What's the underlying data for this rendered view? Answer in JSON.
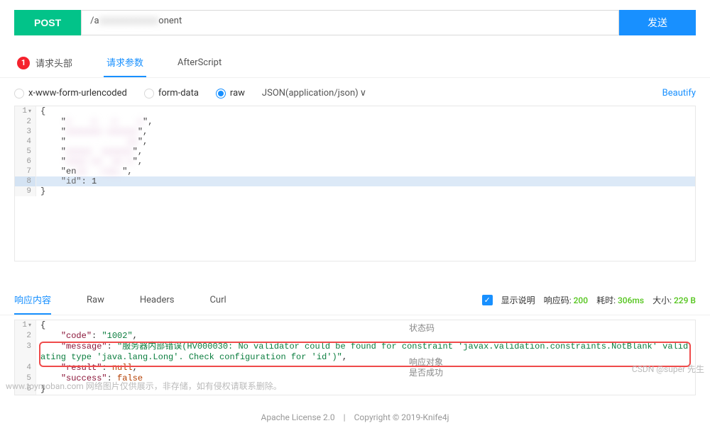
{
  "request": {
    "method": "POST",
    "url_visible_prefix": "/a",
    "url_visible_suffix": "onent",
    "send_label": "发送"
  },
  "tabs": {
    "badge": "1",
    "headers": "请求头部",
    "params": "请求参数",
    "after_script": "AfterScript"
  },
  "body_types": {
    "urlencoded": "x-www-form-urlencoded",
    "form_data": "form-data",
    "raw": "raw",
    "content_type": "JSON(application/json)",
    "beautify": "Beautify"
  },
  "request_body": {
    "lines": [
      {
        "n": 1,
        "fold": true,
        "text": "{"
      },
      {
        "n": 2,
        "text": "    \"",
        "blur": "c    x   x    x"
      },
      {
        "n": 3,
        "text": "    \"",
        "blur": "xxxxxxx xxxxxx"
      },
      {
        "n": 4,
        "text": "    \"",
        "blur": "            xx"
      },
      {
        "n": 5,
        "text": "    \"",
        "blur": "xxxxx  xxxxxx"
      },
      {
        "n": 6,
        "text": "    \"",
        "blur": "xxxx xx  xx x"
      },
      {
        "n": 7,
        "text": "    \"en",
        "blur": "xx  .rux,"
      },
      {
        "n": 8,
        "hl": true,
        "key": "id",
        "val": "1"
      },
      {
        "n": 9,
        "text": "}"
      }
    ]
  },
  "response_tabs": {
    "content": "响应内容",
    "raw": "Raw",
    "headers": "Headers",
    "curl": "Curl"
  },
  "response_meta": {
    "show_desc": "显示说明",
    "status_label": "响应码:",
    "status_code": "200",
    "time_label": "耗时:",
    "time_value": "306ms",
    "size_label": "大小:",
    "size_value": "229 B"
  },
  "response_body": {
    "lines": [
      {
        "n": 1,
        "fold": true,
        "raw": "{"
      },
      {
        "n": 2,
        "key": "code",
        "val": "1002",
        "comma": true
      },
      {
        "n": 3,
        "key": "message",
        "val": "服务器内部错误(HV000030: No validator could be found for constraint 'javax.validation.constraints.NotBlank' validating type 'java.lang.Long'. Check configuration for 'id')",
        "comma": true
      },
      {
        "n": 4,
        "key": "result",
        "val": "null",
        "lit": true,
        "comma": true
      },
      {
        "n": 5,
        "key": "success",
        "val": "false",
        "lit": true
      },
      {
        "n": 6,
        "raw": "}"
      }
    ]
  },
  "annotations": {
    "status_code": "状态码",
    "response_obj": "响应对象",
    "is_success": "是否成功"
  },
  "footer": {
    "license": "Apache License 2.0",
    "copyright": "Copyright © 2019-Knife4j"
  },
  "watermarks": {
    "left": "www.toymoban.com  网络图片仅供展示，非存储，如有侵权请联系删除。",
    "right": "CSDN @super 先生"
  }
}
